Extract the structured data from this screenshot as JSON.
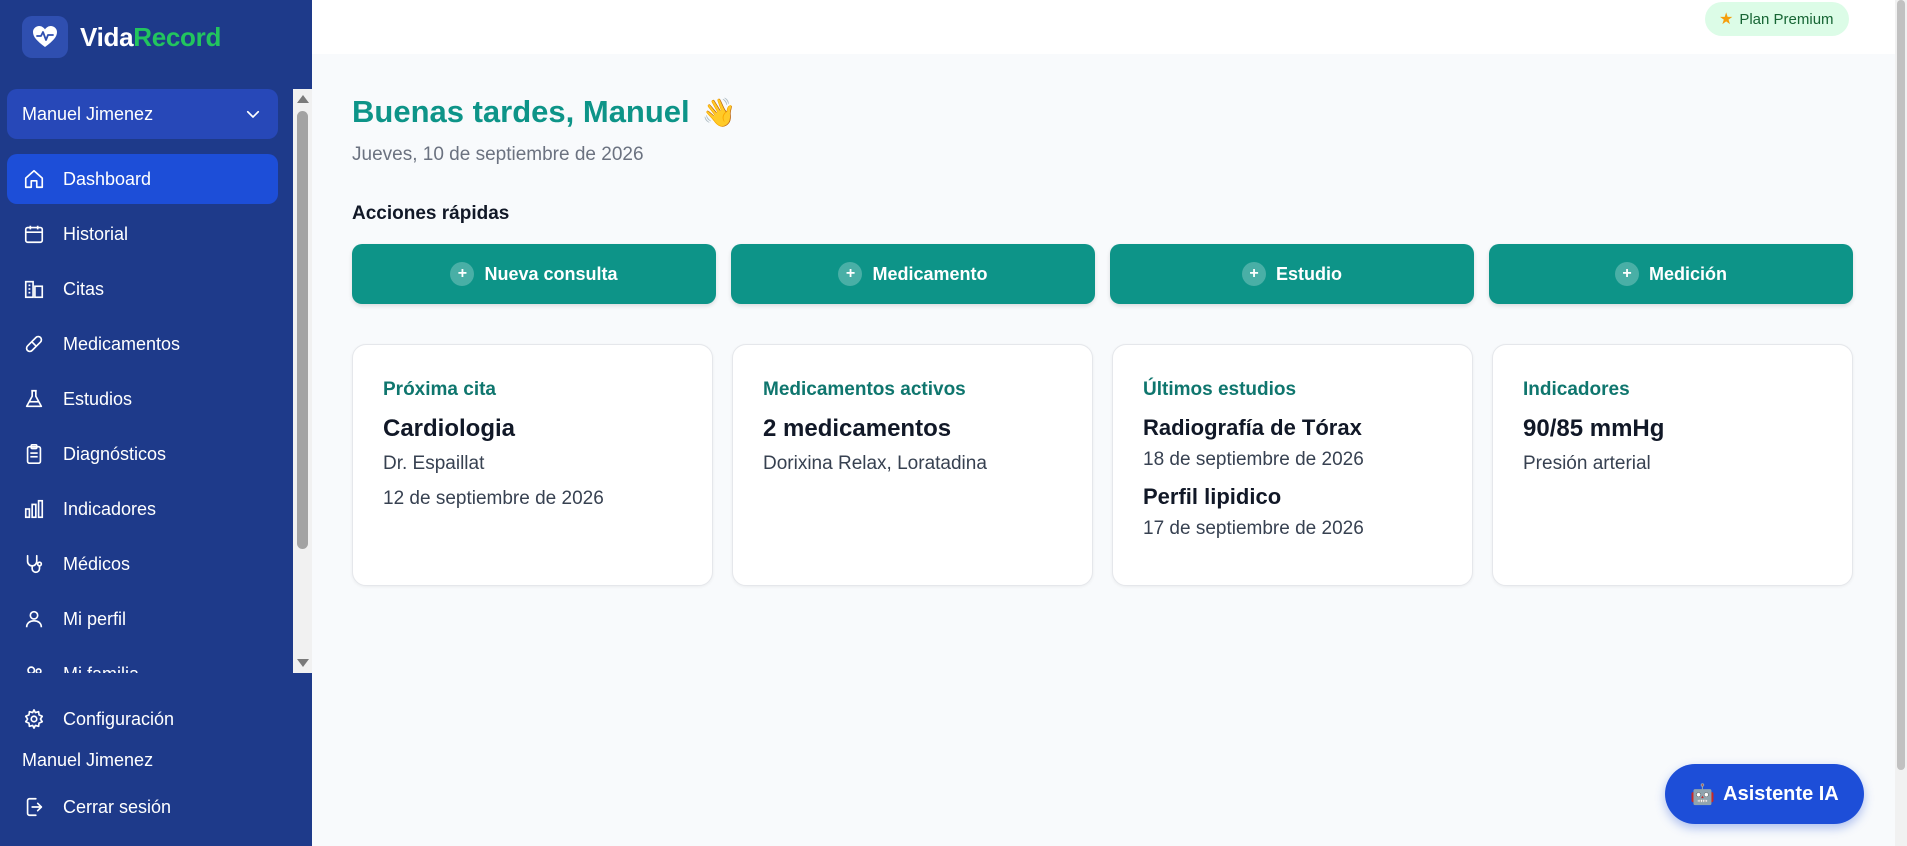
{
  "brand": {
    "name_part1": "Vida",
    "name_part2": "Record"
  },
  "topbar": {
    "premium_label": "Plan Premium"
  },
  "sidebar": {
    "user_select": "Manuel Jimenez",
    "items": [
      {
        "label": "Dashboard",
        "icon": "home-icon",
        "active": true
      },
      {
        "label": "Historial",
        "icon": "calendar-icon"
      },
      {
        "label": "Citas",
        "icon": "building-icon"
      },
      {
        "label": "Medicamentos",
        "icon": "pill-icon"
      },
      {
        "label": "Estudios",
        "icon": "flask-icon"
      },
      {
        "label": "Diagnósticos",
        "icon": "clipboard-icon"
      },
      {
        "label": "Indicadores",
        "icon": "bar-chart-icon"
      },
      {
        "label": "Médicos",
        "icon": "stethoscope-icon"
      },
      {
        "label": "Mi perfil",
        "icon": "user-icon"
      },
      {
        "label": "Mi familia",
        "icon": "users-icon"
      }
    ],
    "settings_label": "Configuración",
    "bottom_user": "Manuel Jimenez",
    "logout_label": "Cerrar sesión"
  },
  "main": {
    "greeting": "Buenas tardes, Manuel",
    "greeting_emoji": "👋",
    "date": "Jueves, 10 de septiembre de 2026",
    "quick_actions_title": "Acciones rápidas",
    "quick_actions": [
      "Nueva consulta",
      "Medicamento",
      "Estudio",
      "Medición"
    ],
    "cards": {
      "next_appointment": {
        "title": "Próxima cita",
        "specialty": "Cardiologia",
        "doctor": "Dr. Espaillat",
        "date": "12 de septiembre de 2026"
      },
      "active_meds": {
        "title": "Medicamentos activos",
        "count": "2 medicamentos",
        "names": "Dorixina Relax, Loratadina"
      },
      "latest_studies": {
        "title": "Últimos estudios",
        "items": [
          {
            "name": "Radiografía de Tórax",
            "date": "18 de septiembre de 2026"
          },
          {
            "name": "Perfil lipidico",
            "date": "17 de septiembre de 2026"
          }
        ]
      },
      "indicators": {
        "title": "Indicadores",
        "value": "90/85 mmHg",
        "label": "Presión arterial"
      }
    }
  },
  "assistant": {
    "label": "Asistente IA",
    "icon": "robot-icon"
  },
  "colors": {
    "sidebar": "#1e3a8a",
    "accent": "#0d9488",
    "active": "#1d4ed8",
    "brand_green": "#22c55e"
  }
}
